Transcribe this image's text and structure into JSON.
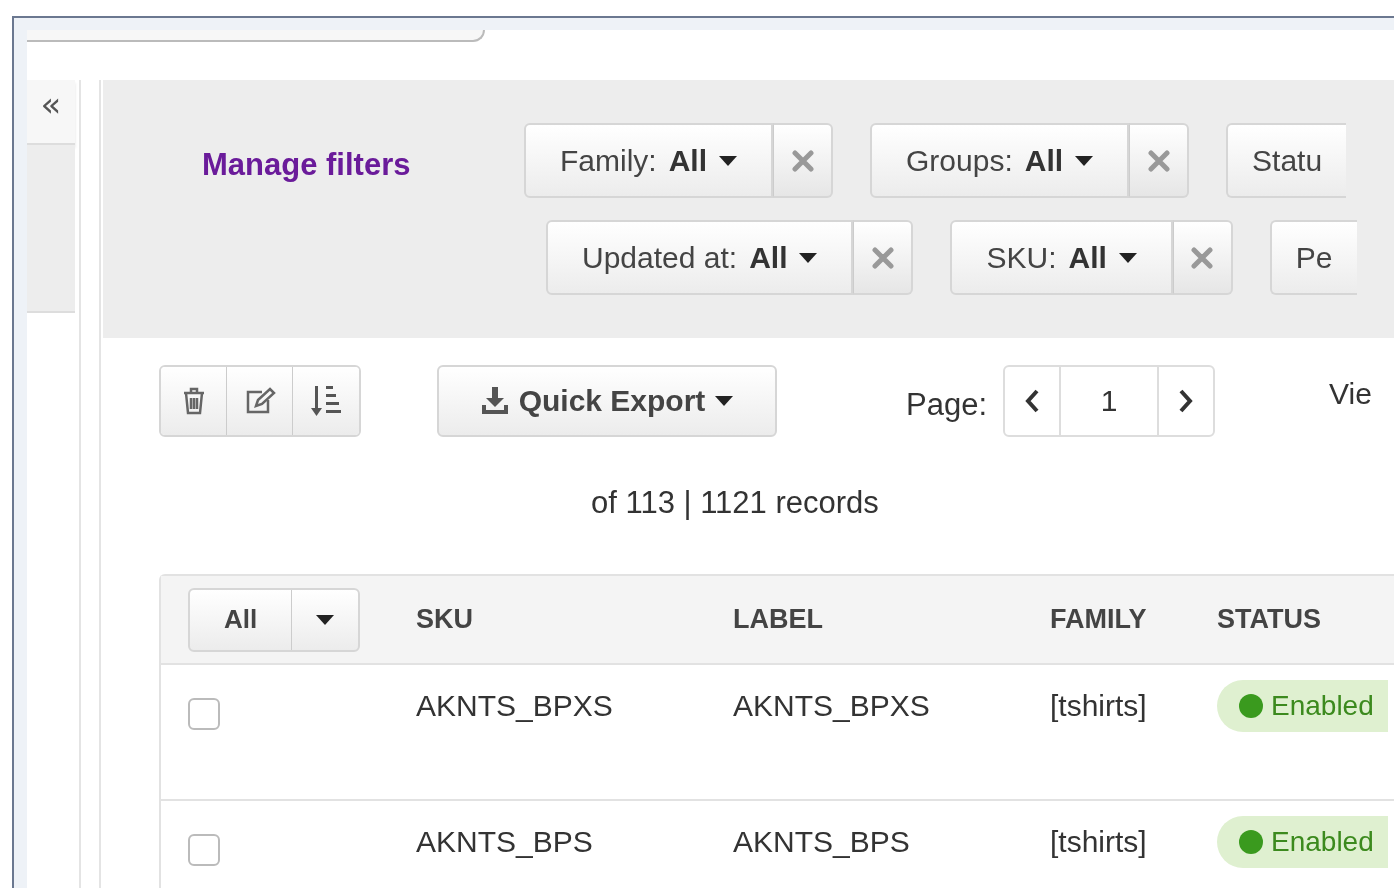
{
  "sidebar": {
    "collapse": "«"
  },
  "filters": {
    "manage_label": "Manage filters",
    "rows": [
      [
        {
          "label": "Family:",
          "value": "All",
          "removable": true
        },
        {
          "label": "Groups:",
          "value": "All",
          "removable": true
        },
        {
          "label": "Statu",
          "removable": false
        }
      ],
      [
        {
          "label": "Updated at:",
          "value": "All",
          "removable": true
        },
        {
          "label": "SKU:",
          "value": "All",
          "removable": true
        },
        {
          "label": "Pe",
          "removable": false
        }
      ]
    ]
  },
  "toolbar": {
    "quick_export": "Quick Export",
    "page_label": "Page:",
    "page": "1",
    "view_label": "Vie",
    "records": "of 113 | 1121 records"
  },
  "table": {
    "select_all": "All",
    "columns": [
      "SKU",
      "LABEL",
      "FAMILY",
      "STATUS"
    ],
    "rows": [
      {
        "checked": false,
        "sku": "AKNTS_BPXS",
        "label": "AKNTS_BPXS",
        "family": "[tshirts]",
        "status": {
          "text": "Enabled",
          "enabled": true
        }
      },
      {
        "checked": false,
        "sku": "AKNTS_BPS",
        "label": "AKNTS_BPS",
        "family": "[tshirts]",
        "status": {
          "text": "Enabled",
          "enabled": true
        }
      }
    ]
  }
}
